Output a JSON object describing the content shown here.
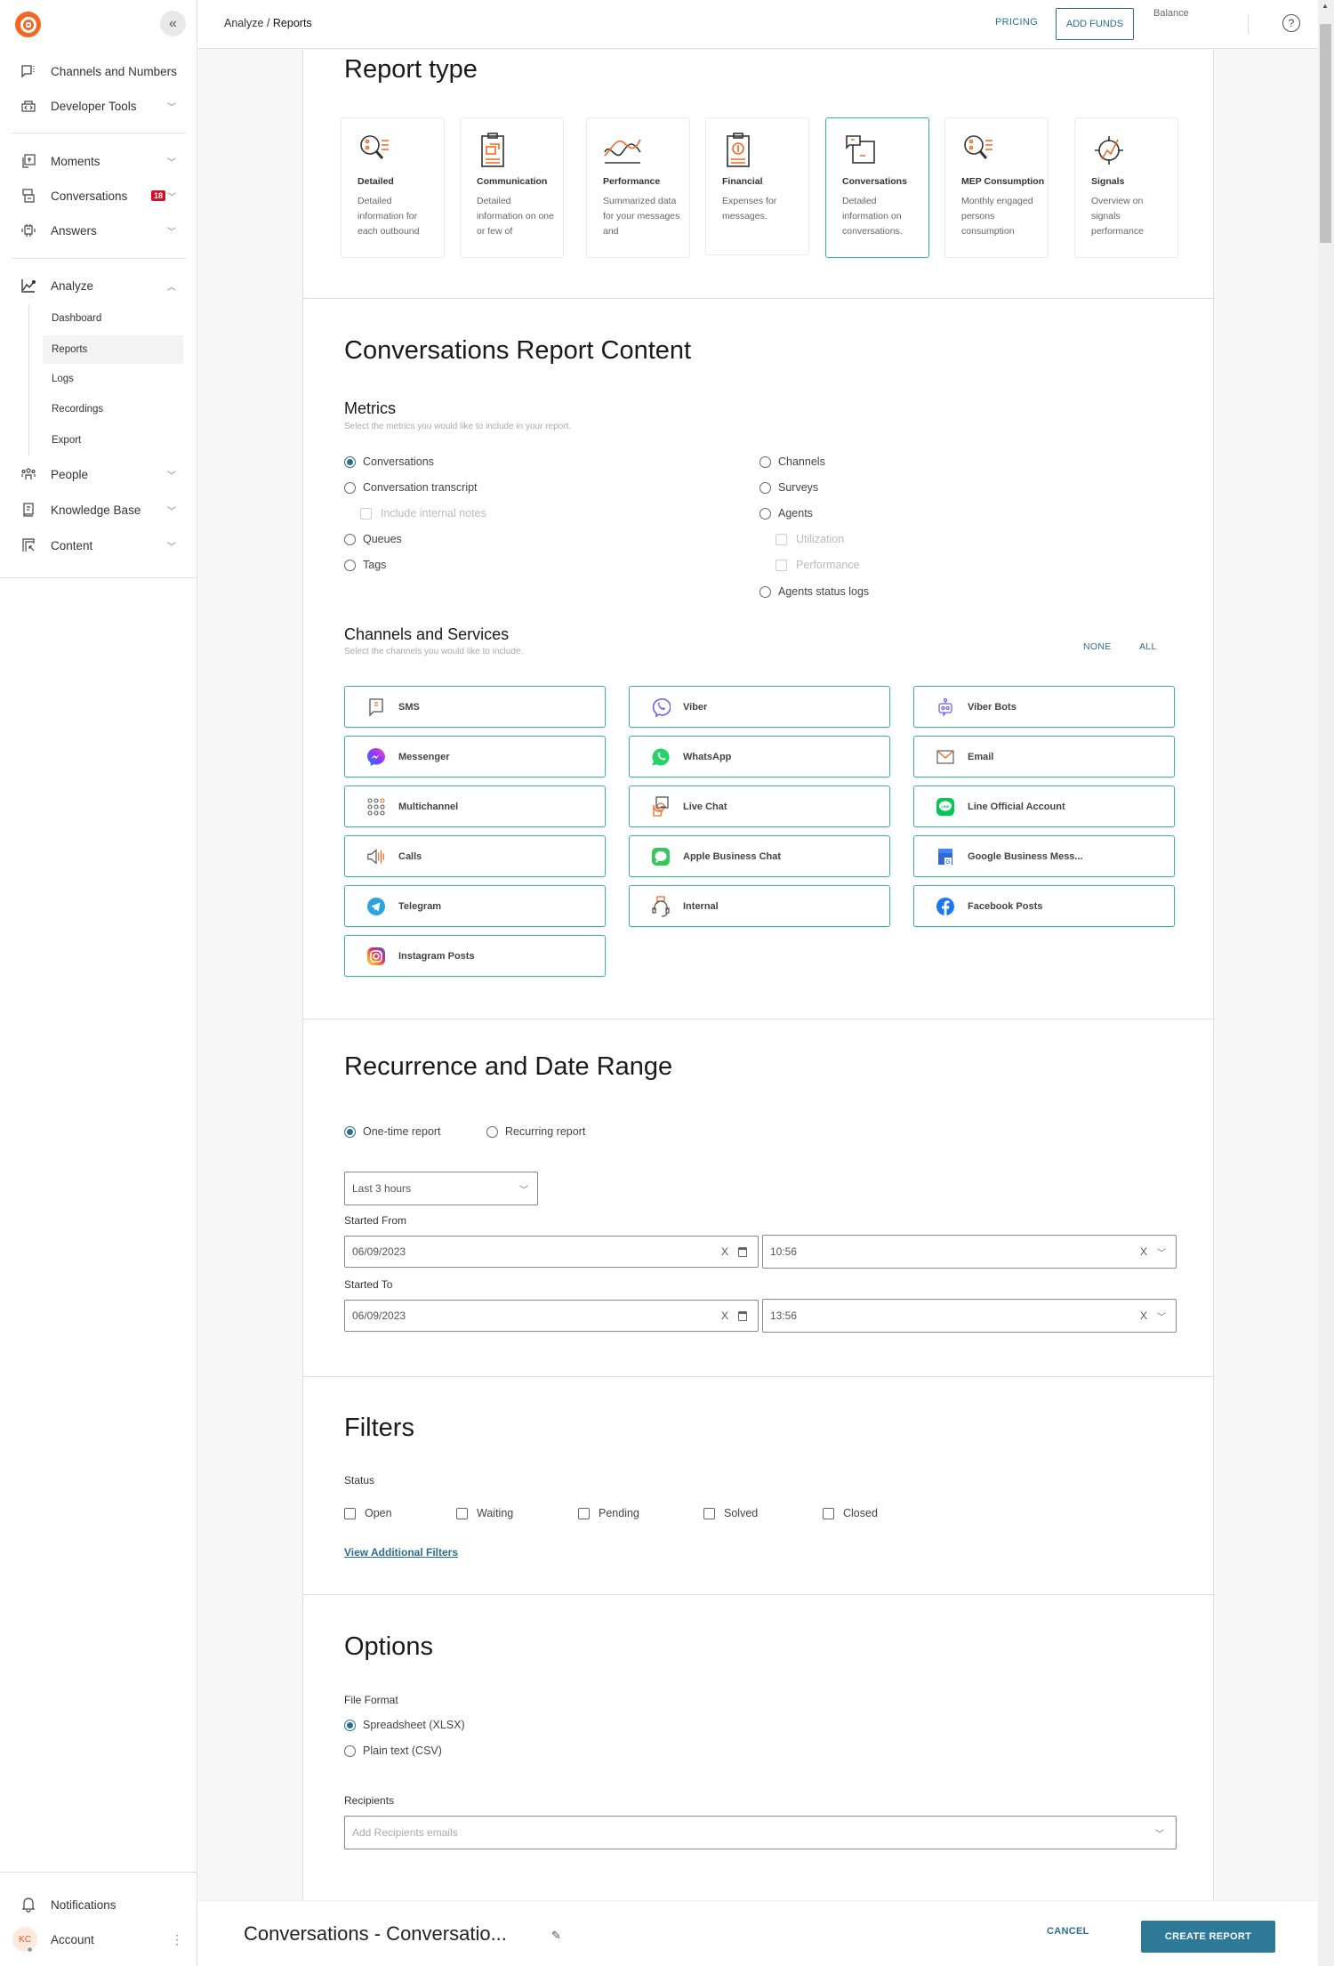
{
  "sidebar": {
    "collapse_label": "«",
    "items": [
      {
        "label": "Channels and Numbers",
        "icon": "chat-bubble-icon",
        "has_chevron": false
      },
      {
        "label": "Developer Tools",
        "icon": "code-icon",
        "has_chevron": true
      },
      {
        "label": "Moments",
        "icon": "moments-icon",
        "has_chevron": true
      },
      {
        "label": "Conversations",
        "icon": "conversations-icon",
        "has_chevron": true,
        "badge": "18"
      },
      {
        "label": "Answers",
        "icon": "bot-icon",
        "has_chevron": true
      },
      {
        "label": "Analyze",
        "icon": "chart-line-icon",
        "has_chevron": true,
        "expanded": true
      },
      {
        "label": "People",
        "icon": "people-icon",
        "has_chevron": true
      },
      {
        "label": "Knowledge Base",
        "icon": "book-icon",
        "has_chevron": true
      },
      {
        "label": "Content",
        "icon": "content-icon",
        "has_chevron": true
      }
    ],
    "analyze_sub": [
      {
        "label": "Dashboard",
        "active": false
      },
      {
        "label": "Reports",
        "active": true
      },
      {
        "label": "Logs",
        "active": false
      },
      {
        "label": "Recordings",
        "active": false
      },
      {
        "label": "Export",
        "active": false
      }
    ],
    "bottom": {
      "notifications": "Notifications",
      "account": "Account",
      "avatar_initials": "KC",
      "more": "⋮"
    }
  },
  "topbar": {
    "breadcrumb_parent": "Analyze",
    "breadcrumb_sep": " / ",
    "breadcrumb_current": "Reports",
    "pricing": "PRICING",
    "add_funds": "ADD FUNDS",
    "balance": "Balance",
    "help": "?"
  },
  "report_type": {
    "title": "Report type",
    "cards": [
      {
        "title": "Detailed",
        "desc": "Detailed information for each outbound",
        "icon": "magnifier-list-icon",
        "selected": false
      },
      {
        "title": "Communication",
        "desc": "Detailed information on one or few of",
        "icon": "clipboard-flow-icon",
        "selected": false
      },
      {
        "title": "Performance",
        "desc": "Summarized data for your messages and",
        "icon": "wave-chart-icon",
        "selected": false
      },
      {
        "title": "Financial",
        "desc": "Expenses for messages.",
        "icon": "clipboard-dollar-icon",
        "selected": false
      },
      {
        "title": "Conversations",
        "desc": "Detailed information on conversations.",
        "icon": "conversation-windows-icon",
        "selected": true
      },
      {
        "title": "MEP Consumption",
        "desc": "Monthly engaged persons consumption",
        "icon": "magnifier-list-icon",
        "selected": false
      },
      {
        "title": "Signals",
        "desc": "Overview on signals performance",
        "icon": "signal-target-icon",
        "selected": false
      }
    ]
  },
  "content": {
    "title": "Conversations Report Content",
    "metrics": {
      "title": "Metrics",
      "hint": "Select the metrics you would like to include in your report.",
      "left": [
        {
          "label": "Conversations",
          "type": "radio",
          "checked": true
        },
        {
          "label": "Conversation transcript",
          "type": "radio",
          "checked": false
        },
        {
          "label": "Include internal notes",
          "type": "checkbox",
          "disabled": true
        },
        {
          "label": "Queues",
          "type": "radio",
          "checked": false
        },
        {
          "label": "Tags",
          "type": "radio",
          "checked": false
        }
      ],
      "right": [
        {
          "label": "Channels",
          "type": "radio",
          "checked": false
        },
        {
          "label": "Surveys",
          "type": "radio",
          "checked": false
        },
        {
          "label": "Agents",
          "type": "radio",
          "checked": false
        },
        {
          "label": "Utilization",
          "type": "checkbox",
          "disabled": true
        },
        {
          "label": "Performance",
          "type": "checkbox",
          "disabled": true
        },
        {
          "label": "Agents status logs",
          "type": "radio",
          "checked": false
        }
      ]
    },
    "channels": {
      "title": "Channels and Services",
      "hint": "Select the channels you would like to include.",
      "none": "NONE",
      "all": "ALL",
      "items": [
        {
          "label": "SMS",
          "icon": "sms-icon"
        },
        {
          "label": "Viber",
          "icon": "viber-icon"
        },
        {
          "label": "Viber Bots",
          "icon": "viber-bots-icon"
        },
        {
          "label": "Messenger",
          "icon": "messenger-icon"
        },
        {
          "label": "WhatsApp",
          "icon": "whatsapp-icon"
        },
        {
          "label": "Email",
          "icon": "email-icon"
        },
        {
          "label": "Multichannel",
          "icon": "multichannel-icon"
        },
        {
          "label": "Live Chat",
          "icon": "live-chat-icon"
        },
        {
          "label": "Line Official Account",
          "icon": "line-icon"
        },
        {
          "label": "Calls",
          "icon": "calls-icon"
        },
        {
          "label": "Apple Business Chat",
          "icon": "apple-business-chat-icon"
        },
        {
          "label": "Google Business Mess...",
          "icon": "google-business-icon"
        },
        {
          "label": "Telegram",
          "icon": "telegram-icon"
        },
        {
          "label": "Internal",
          "icon": "internal-icon"
        },
        {
          "label": "Facebook Posts",
          "icon": "facebook-icon"
        },
        {
          "label": "Instagram Posts",
          "icon": "instagram-icon"
        }
      ]
    }
  },
  "recurrence": {
    "title": "Recurrence and Date Range",
    "one_time": "One-time report",
    "recurring": "Recurring report",
    "one_time_selected": true,
    "range_select": "Last 3 hours",
    "started_from_label": "Started From",
    "started_from_date": "06/09/2023",
    "started_from_time": "10:56",
    "started_to_label": "Started To",
    "started_to_date": "06/09/2023",
    "started_to_time": "13:56",
    "clear_glyph": "X",
    "chevron_glyph": "⌵"
  },
  "filters": {
    "title": "Filters",
    "status_label": "Status",
    "statuses": [
      "Open",
      "Waiting",
      "Pending",
      "Solved",
      "Closed"
    ],
    "additional": "View Additional Filters"
  },
  "options": {
    "title": "Options",
    "file_format_label": "File Format",
    "formats": [
      {
        "label": "Spreadsheet (XLSX)",
        "checked": true
      },
      {
        "label": "Plain text (CSV)",
        "checked": false
      }
    ],
    "recipients_label": "Recipients",
    "recipients_placeholder": "Add Recipients emails"
  },
  "footer": {
    "report_name": "Conversations - Conversatio...",
    "cancel": "CANCEL",
    "create": "CREATE REPORT"
  },
  "colors": {
    "brand": "#f26722",
    "accent": "#2b6f8f",
    "selected_border": "#3bb39a",
    "badge": "#d0112b"
  }
}
